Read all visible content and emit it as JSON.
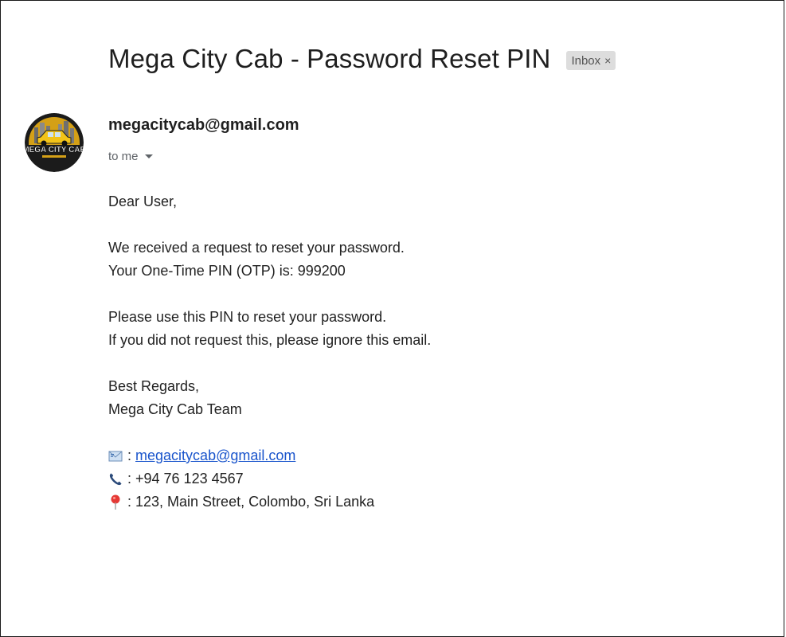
{
  "email": {
    "subject": "Mega City Cab - Password Reset PIN",
    "label_chip": "Inbox",
    "label_chip_close": "×",
    "avatar_text": "MEGA CITY CAB",
    "sender": "megacitycab@gmail.com",
    "recipient_line": "to me",
    "body": {
      "greeting": "Dear User,",
      "line1": "We received a request to reset your password.",
      "line2": "Your One-Time PIN (OTP) is: 999200",
      "line3": "Please use this PIN to reset your password.",
      "line4": "If you did not request this, please ignore this email.",
      "signoff1": "Best Regards,",
      "signoff2": "Mega City Cab Team"
    },
    "contact": {
      "email_sep": ":",
      "email": "megacitycab@gmail.com",
      "phone": ": +94 76 123 4567",
      "address": ": 123, Main Street, Colombo, Sri Lanka"
    }
  },
  "icons": {
    "email": "envelope-icon",
    "phone": "phone-icon",
    "address": "location-pin-icon",
    "caret": "chevron-down-icon"
  },
  "colors": {
    "link": "#1a55cc",
    "chip_bg": "#dddddd",
    "pin_red": "#e53935",
    "phone_blue": "#2b4a7a"
  }
}
